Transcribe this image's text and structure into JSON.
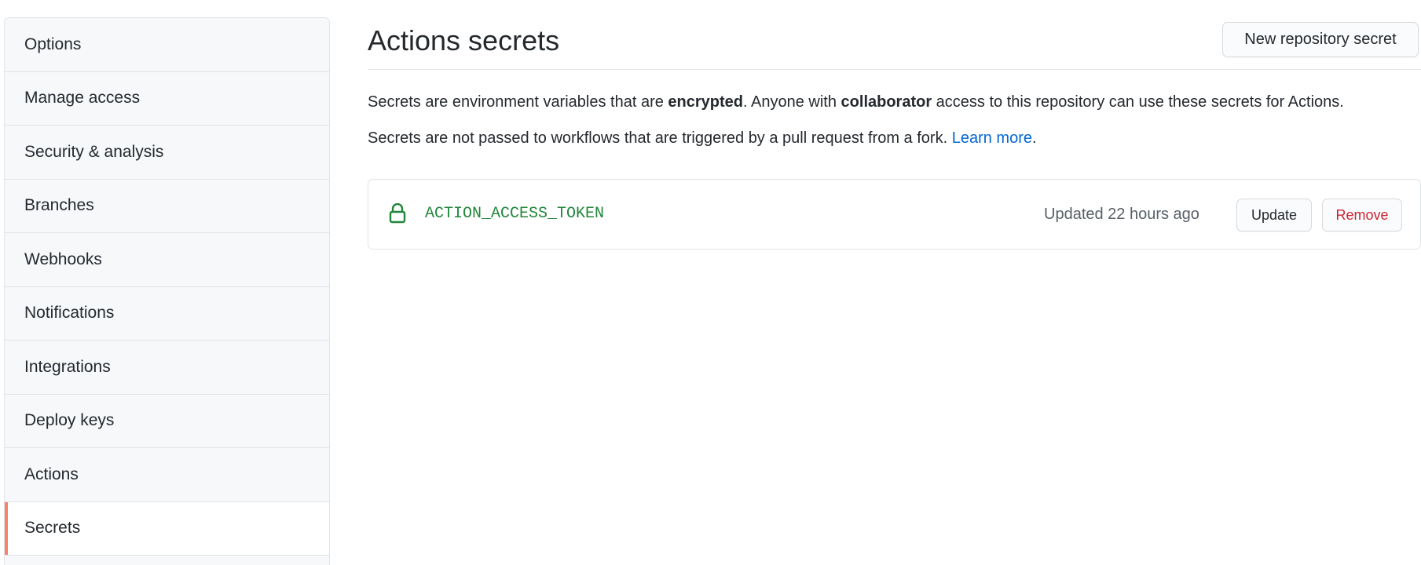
{
  "sidebar": {
    "items": [
      {
        "label": "Options"
      },
      {
        "label": "Manage access"
      },
      {
        "label": "Security & analysis"
      },
      {
        "label": "Branches"
      },
      {
        "label": "Webhooks"
      },
      {
        "label": "Notifications"
      },
      {
        "label": "Integrations"
      },
      {
        "label": "Deploy keys"
      },
      {
        "label": "Actions"
      },
      {
        "label": "Secrets",
        "selected": true
      }
    ]
  },
  "header": {
    "title": "Actions secrets",
    "new_secret_label": "New repository secret"
  },
  "description": {
    "line1_part1": "Secrets are environment variables that are ",
    "line1_bold1": "encrypted",
    "line1_part2": ". Anyone with ",
    "line1_bold2": "collaborator",
    "line1_part3": " access to this repository can use these secrets for Actions.",
    "line2_text": "Secrets are not passed to workflows that are triggered by a pull request from a fork. ",
    "line2_link": "Learn more",
    "line2_end": "."
  },
  "secrets": [
    {
      "name": "ACTION_ACCESS_TOKEN",
      "updated": "Updated 22 hours ago",
      "update_label": "Update",
      "remove_label": "Remove",
      "icon": "lock-icon"
    }
  ],
  "colors": {
    "accent_selected": "#f9826c",
    "secret_name": "#22863a",
    "link": "#0366d6",
    "danger": "#cb2431"
  }
}
